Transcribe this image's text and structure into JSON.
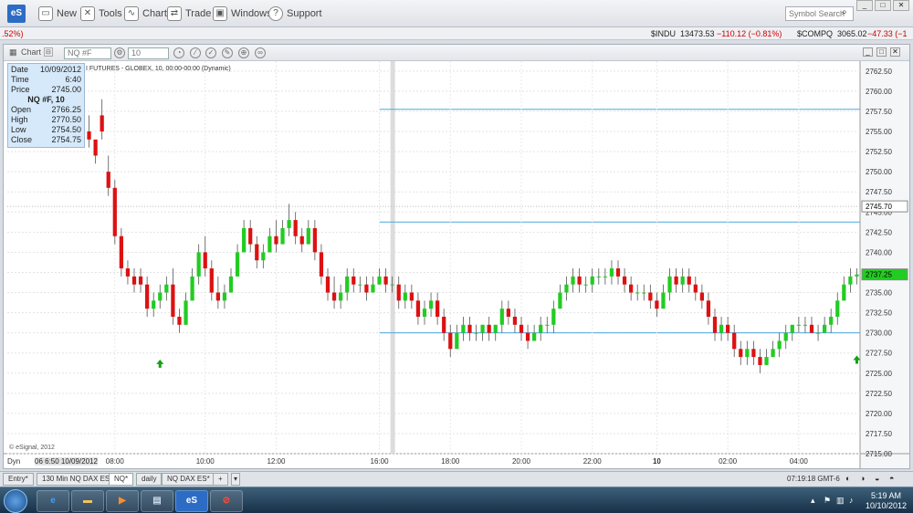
{
  "app": {
    "logo": "eS",
    "toolbar": [
      {
        "label": "New",
        "icon": "new-icon"
      },
      {
        "label": "Tools",
        "icon": "tools-icon"
      },
      {
        "label": "Chart",
        "icon": "chart-icon"
      },
      {
        "label": "Trade",
        "icon": "trade-icon"
      },
      {
        "label": "Windows",
        "icon": "windows-icon"
      },
      {
        "label": "Support",
        "icon": "help-icon"
      }
    ],
    "search_placeholder": "Symbol Search"
  },
  "ticker": {
    "left": ".52%)",
    "indu_sym": "$INDU",
    "indu_val": "13473.53",
    "indu_chg": "−110.12 (−0.81%)",
    "comp_sym": "$COMPQ",
    "comp_val": "3065.02",
    "comp_chg": "−47.33 (−1"
  },
  "chart_window": {
    "title": "Chart",
    "symbol": "NQ #F",
    "interval": "10",
    "subtitle": "I FUTURES - GLOBEX, 10, 00:00-00:00 (Dynamic)",
    "copyright": "© eSignal, 2012",
    "dyn": "Dyn",
    "date_label": "06 6:50 10/09/2012"
  },
  "info": {
    "date_label": "Date",
    "date": "10/09/2012",
    "time_label": "Time",
    "time": "6:40",
    "price_label": "Price",
    "price": "2745.00",
    "symbol": "NQ #F, 10",
    "open_label": "Open",
    "open": "2766.25",
    "high_label": "High",
    "high": "2770.50",
    "low_label": "Low",
    "low": "2754.50",
    "close_label": "Close",
    "close": "2754.75"
  },
  "chart_data": {
    "type": "candlestick",
    "yticks": [
      2762.5,
      2760,
      2757.5,
      2755,
      2752.5,
      2750,
      2747.5,
      2745,
      2742.5,
      2740,
      2737.5,
      2735,
      2732.5,
      2730,
      2727.5,
      2725,
      2722.5,
      2720,
      2717.5,
      2715
    ],
    "xticks": [
      "08:00",
      "10:00",
      "12:00",
      "16:00",
      "18:00",
      "20:00",
      "22:00",
      "10",
      "02:00",
      "04:00"
    ],
    "ylim": [
      2715,
      2763.5
    ],
    "hlines": [
      2757.75,
      2743.75,
      2730.0
    ],
    "price_marks": [
      {
        "value": "2745.70",
        "color": "#ffffff"
      },
      {
        "value": "2737.25",
        "color": "#22cc22"
      }
    ],
    "bullish_color": "#22cc22",
    "bearish_color": "#dd1111",
    "arrows": [
      {
        "index": 11,
        "price": 2728.5
      },
      {
        "index": 130,
        "price": 2729.0
      }
    ],
    "ohlc": [
      [
        2755,
        2757,
        2753,
        2754
      ],
      [
        2754,
        2752,
        2751,
        2752
      ],
      [
        2757,
        2759,
        2754,
        2755
      ],
      [
        2750,
        2752,
        2747,
        2748
      ],
      [
        2748,
        2749,
        2741,
        2742
      ],
      [
        2742,
        2743,
        2737,
        2738
      ],
      [
        2738,
        2739,
        2736,
        2737
      ],
      [
        2737,
        2738,
        2735,
        2736
      ],
      [
        2737,
        2738,
        2735,
        2736
      ],
      [
        2736,
        2737,
        2732,
        2733
      ],
      [
        2733,
        2735,
        2732,
        2734
      ],
      [
        2734,
        2736,
        2733,
        2735
      ],
      [
        2735,
        2737,
        2734,
        2736
      ],
      [
        2736,
        2738,
        2731,
        2732
      ],
      [
        2732,
        2733,
        2730,
        2731
      ],
      [
        2731,
        2735,
        2731,
        2734
      ],
      [
        2734,
        2738,
        2734,
        2737
      ],
      [
        2737,
        2741,
        2736,
        2740
      ],
      [
        2740,
        2742,
        2737,
        2738
      ],
      [
        2738,
        2739,
        2734,
        2735
      ],
      [
        2735,
        2737,
        2733,
        2734
      ],
      [
        2734,
        2736,
        2733,
        2735
      ],
      [
        2735,
        2738,
        2735,
        2737
      ],
      [
        2737,
        2741,
        2737,
        2740
      ],
      [
        2740,
        2744,
        2740,
        2743
      ],
      [
        2743,
        2744,
        2740,
        2741
      ],
      [
        2741,
        2742,
        2738,
        2739
      ],
      [
        2739,
        2741,
        2738,
        2740
      ],
      [
        2740,
        2743,
        2740,
        2742
      ],
      [
        2742,
        2744,
        2740,
        2741
      ],
      [
        2741,
        2744,
        2741,
        2743
      ],
      [
        2743,
        2746,
        2742,
        2744
      ],
      [
        2744,
        2745,
        2741,
        2742
      ],
      [
        2742,
        2743,
        2740,
        2741
      ],
      [
        2741,
        2744,
        2741,
        2743
      ],
      [
        2743,
        2744,
        2739,
        2740
      ],
      [
        2740,
        2741,
        2736,
        2737
      ],
      [
        2737,
        2738,
        2734,
        2735
      ],
      [
        2735,
        2737,
        2733,
        2734
      ],
      [
        2734,
        2736,
        2733,
        2735
      ],
      [
        2735,
        2738,
        2734,
        2737
      ],
      [
        2737,
        2738,
        2735,
        2736
      ],
      [
        2736,
        2737,
        2735,
        2736
      ],
      [
        2736,
        2737,
        2734,
        2735
      ],
      [
        2735,
        2737,
        2735,
        2736
      ],
      [
        2736,
        2738,
        2736,
        2737
      ],
      [
        2737,
        2738,
        2735,
        2736
      ],
      [
        2736,
        2737,
        2735,
        2736
      ],
      [
        2736,
        2737,
        2733,
        2734
      ],
      [
        2734,
        2736,
        2733,
        2735
      ],
      [
        2735,
        2736,
        2733,
        2734
      ],
      [
        2734,
        2735,
        2731,
        2732
      ],
      [
        2732,
        2734,
        2731,
        2733
      ],
      [
        2733,
        2735,
        2732,
        2734
      ],
      [
        2734,
        2735,
        2731,
        2732
      ],
      [
        2732,
        2733,
        2729,
        2730
      ],
      [
        2730,
        2731,
        2727,
        2728
      ],
      [
        2728,
        2731,
        2728,
        2730
      ],
      [
        2730,
        2732,
        2729,
        2731
      ],
      [
        2731,
        2732,
        2729,
        2730
      ],
      [
        2730,
        2731,
        2729,
        2730
      ],
      [
        2730,
        2731,
        2729,
        2731
      ],
      [
        2731,
        2732,
        2729,
        2730
      ],
      [
        2730,
        2731,
        2729,
        2731
      ],
      [
        2731,
        2734,
        2730,
        2733
      ],
      [
        2733,
        2734,
        2731,
        2732
      ],
      [
        2732,
        2733,
        2730,
        2731
      ],
      [
        2731,
        2732,
        2729,
        2730
      ],
      [
        2730,
        2731,
        2728,
        2729
      ],
      [
        2729,
        2731,
        2729,
        2730
      ],
      [
        2730,
        2732,
        2729,
        2731
      ],
      [
        2731,
        2732,
        2730,
        2731
      ],
      [
        2731,
        2734,
        2730,
        2733
      ],
      [
        2733,
        2736,
        2733,
        2735
      ],
      [
        2735,
        2737,
        2734,
        2736
      ],
      [
        2736,
        2738,
        2735,
        2737
      ],
      [
        2737,
        2738,
        2735,
        2736
      ],
      [
        2736,
        2737,
        2735,
        2736
      ],
      [
        2736,
        2738,
        2735,
        2737
      ],
      [
        2737,
        2738,
        2736,
        2737
      ],
      [
        2737,
        2738,
        2736,
        2737
      ],
      [
        2737,
        2739,
        2736,
        2738
      ],
      [
        2738,
        2739,
        2736,
        2737
      ],
      [
        2737,
        2738,
        2735,
        2736
      ],
      [
        2736,
        2737,
        2734,
        2735
      ],
      [
        2735,
        2736,
        2734,
        2735
      ],
      [
        2735,
        2736,
        2734,
        2735
      ],
      [
        2735,
        2736,
        2733,
        2734
      ],
      [
        2734,
        2735,
        2732,
        2733
      ],
      [
        2733,
        2736,
        2733,
        2735
      ],
      [
        2735,
        2738,
        2734,
        2737
      ],
      [
        2737,
        2738,
        2735,
        2736
      ],
      [
        2736,
        2738,
        2735,
        2737
      ],
      [
        2737,
        2738,
        2735,
        2736
      ],
      [
        2736,
        2737,
        2734,
        2735
      ],
      [
        2735,
        2736,
        2733,
        2734
      ],
      [
        2734,
        2735,
        2731,
        2732
      ],
      [
        2732,
        2733,
        2729,
        2730
      ],
      [
        2730,
        2732,
        2729,
        2731
      ],
      [
        2731,
        2732,
        2729,
        2730
      ],
      [
        2730,
        2731,
        2727,
        2728
      ],
      [
        2728,
        2729,
        2726,
        2727
      ],
      [
        2727,
        2729,
        2726,
        2728
      ],
      [
        2728,
        2729,
        2726,
        2727
      ],
      [
        2727,
        2728,
        2725,
        2726
      ],
      [
        2726,
        2728,
        2726,
        2727
      ],
      [
        2727,
        2729,
        2727,
        2728
      ],
      [
        2728,
        2730,
        2727,
        2729
      ],
      [
        2729,
        2731,
        2728,
        2730
      ],
      [
        2730,
        2731,
        2729,
        2731
      ],
      [
        2731,
        2732,
        2730,
        2731
      ],
      [
        2731,
        2732,
        2730,
        2731
      ],
      [
        2731,
        2732,
        2730,
        2730
      ],
      [
        2730,
        2731,
        2729,
        2730
      ],
      [
        2730,
        2732,
        2730,
        2731
      ],
      [
        2731,
        2733,
        2730,
        2732
      ],
      [
        2732,
        2735,
        2731,
        2734
      ],
      [
        2734,
        2737,
        2734,
        2736
      ],
      [
        2736,
        2738,
        2735,
        2737
      ],
      [
        2737,
        2738,
        2736,
        2737.25
      ]
    ]
  },
  "tabs": [
    {
      "label": "Entry*"
    },
    {
      "label": "130 Min NQ DAX ES*"
    },
    {
      "label": "NQ*",
      "active": true
    },
    {
      "label": "daily"
    },
    {
      "label": "NQ DAX ES*"
    },
    {
      "label": "+"
    }
  ],
  "status_time": "07:19:18 GMT-6",
  "taskbar": {
    "time": "5:19 AM",
    "date": "10/10/2012",
    "apps": [
      "ie",
      "explorer",
      "media",
      "computer",
      "eS",
      "stop"
    ]
  }
}
